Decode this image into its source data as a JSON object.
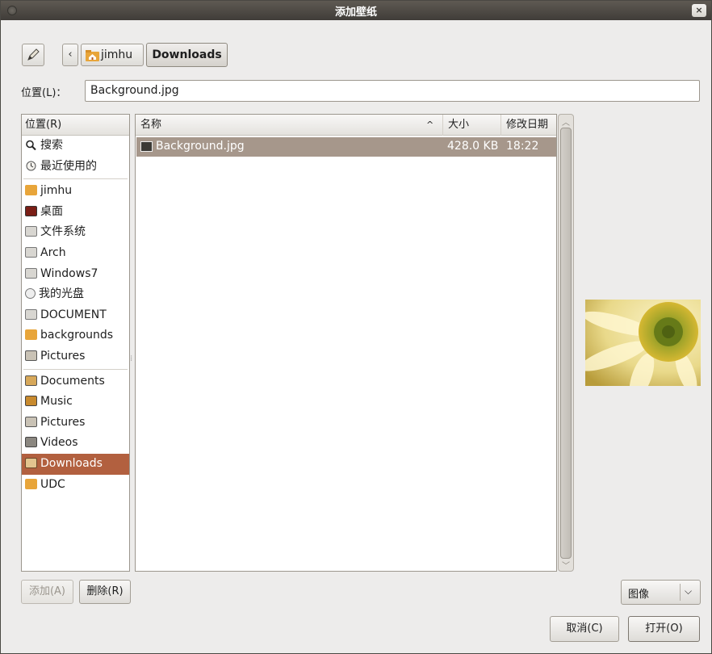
{
  "window": {
    "title": "添加壁纸",
    "close_label": "×"
  },
  "pathbar": {
    "back_label": "‹",
    "home_crumb": "jimhu",
    "current_crumb": "Downloads"
  },
  "location": {
    "label": "位置(L)：",
    "value": "Background.jpg"
  },
  "places": {
    "header": "位置(R)",
    "items": [
      {
        "label": "搜索",
        "icon": "search-icon"
      },
      {
        "label": "最近使用的",
        "icon": "clock-icon"
      },
      {
        "label": "jimhu",
        "icon": "home-folder-icon"
      },
      {
        "label": "桌面",
        "icon": "desktop-icon"
      },
      {
        "label": "文件系统",
        "icon": "drive-icon"
      },
      {
        "label": "Arch",
        "icon": "drive-icon"
      },
      {
        "label": "Windows7",
        "icon": "drive-icon"
      },
      {
        "label": "我的光盘",
        "icon": "cdrom-icon"
      },
      {
        "label": "DOCUMENT",
        "icon": "drive-icon"
      },
      {
        "label": "backgrounds",
        "icon": "folder-icon"
      },
      {
        "label": "Pictures",
        "icon": "pictures-folder-icon"
      },
      {
        "label": "Documents",
        "icon": "documents-folder-icon"
      },
      {
        "label": "Music",
        "icon": "music-folder-icon"
      },
      {
        "label": "Pictures",
        "icon": "pictures-folder-icon"
      },
      {
        "label": "Videos",
        "icon": "videos-folder-icon"
      },
      {
        "label": "Downloads",
        "icon": "downloads-folder-icon",
        "selected": true
      },
      {
        "label": "UDC",
        "icon": "folder-icon"
      }
    ]
  },
  "files": {
    "columns": {
      "name": "名称",
      "size": "大小",
      "date": "修改日期"
    },
    "sort_indicator": "^",
    "rows": [
      {
        "name": "Background.jpg",
        "size": "428.0 KB",
        "date": "18:22"
      }
    ]
  },
  "buttons": {
    "add": "添加(A)",
    "remove": "删除(R)",
    "cancel": "取消(C)",
    "open": "打开(O)"
  },
  "filter": {
    "value": "图像",
    "chevron": "⌵"
  },
  "colors": {
    "selection": "#b2603f",
    "file_selection": "#a6978b",
    "titlebar": "#4a4641"
  }
}
